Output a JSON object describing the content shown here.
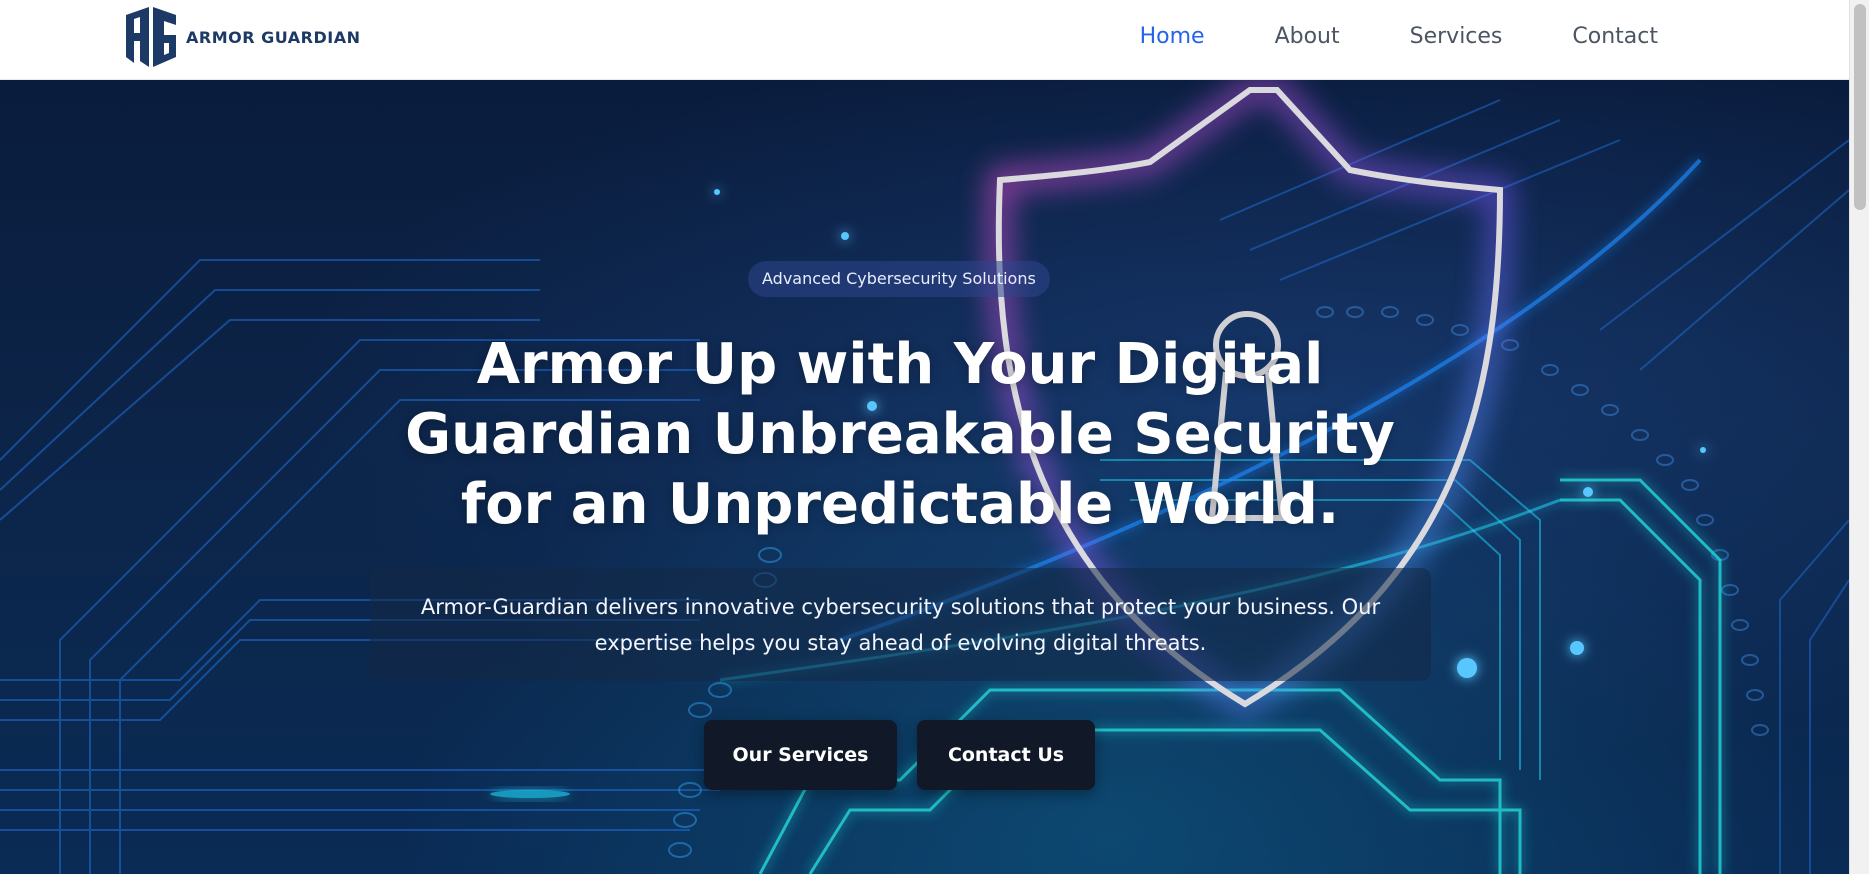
{
  "brand": {
    "name": "ARMOR GUARDIAN",
    "logo_icon": "ag-shield-logo"
  },
  "nav": {
    "items": [
      {
        "label": "Home",
        "active": true
      },
      {
        "label": "About",
        "active": false
      },
      {
        "label": "Services",
        "active": false
      },
      {
        "label": "Contact",
        "active": false
      }
    ]
  },
  "hero": {
    "badge": "Advanced Cybersecurity Solutions",
    "title": "Armor Up with Your Digital Guardian Unbreakable Security for an Unpredictable World.",
    "description": "Armor-Guardian delivers innovative cybersecurity solutions that protect your business. Our expertise helps you stay ahead of evolving digital threats.",
    "buttons": {
      "primary": "Our Services",
      "secondary": "Contact Us"
    }
  },
  "colors": {
    "accent": "#2563eb",
    "nav_text": "#4b5563",
    "hero_bg": "#0a1c3d",
    "button_bg": "#111827",
    "neon_pink": "#ff4fd8",
    "neon_cyan": "#23e0ff"
  }
}
